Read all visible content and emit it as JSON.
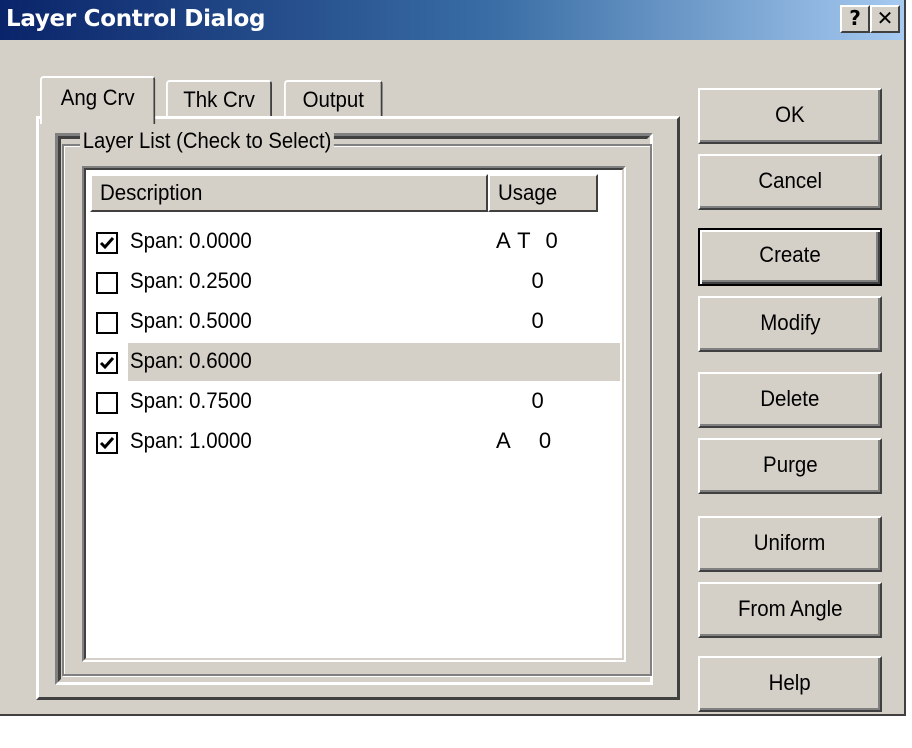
{
  "window": {
    "title": "Layer Control Dialog",
    "help_glyph": "?",
    "close_glyph": "✕"
  },
  "tabs": [
    {
      "label": "Ang Crv",
      "active": true
    },
    {
      "label": "Thk Crv",
      "active": false
    },
    {
      "label": "Output",
      "active": false
    }
  ],
  "group": {
    "legend": "Layer List (Check to Select)"
  },
  "list": {
    "columns": {
      "description": "Description",
      "usage": "Usage"
    },
    "rows": [
      {
        "checked": true,
        "label": "Span: 0.0000",
        "usage": "A T  0",
        "selected": false
      },
      {
        "checked": false,
        "label": "Span: 0.2500",
        "usage": "     0",
        "selected": false
      },
      {
        "checked": false,
        "label": "Span: 0.5000",
        "usage": "     0",
        "selected": false
      },
      {
        "checked": true,
        "label": "Span: 0.6000",
        "usage": "",
        "selected": true
      },
      {
        "checked": false,
        "label": "Span: 0.7500",
        "usage": "     0",
        "selected": false
      },
      {
        "checked": true,
        "label": "Span: 1.0000",
        "usage": "A    0",
        "selected": false
      }
    ]
  },
  "buttons": {
    "ok": "OK",
    "cancel": "Cancel",
    "create": "Create",
    "modify": "Modify",
    "delete": "Delete",
    "purge": "Purge",
    "uniform": "Uniform",
    "from_angle": "From Angle",
    "help": "Help"
  },
  "colors": {
    "face": "#d4d0c8",
    "title_start": "#0a246a",
    "title_end": "#a6caf0",
    "selection": "#d4d0c8"
  }
}
